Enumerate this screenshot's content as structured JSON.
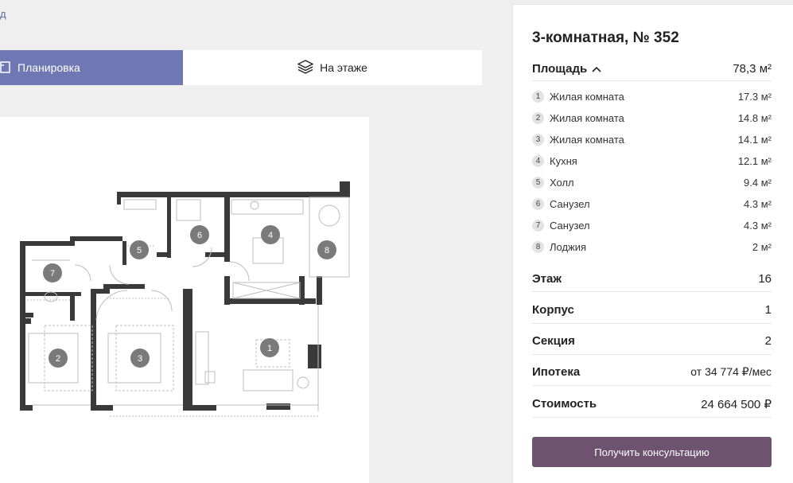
{
  "nav": {
    "back_label": "д"
  },
  "view_tabs": {
    "plan_label": "Планировка",
    "floor_label": "На этаже"
  },
  "apartment": {
    "title": "3-комнатная, № 352",
    "area_label": "Площадь",
    "area_value": "78,3 м²",
    "rooms": [
      {
        "num": "1",
        "name": "Жилая комната",
        "area": "17.3 м²"
      },
      {
        "num": "2",
        "name": "Жилая комната",
        "area": "14.8 м²"
      },
      {
        "num": "3",
        "name": "Жилая комната",
        "area": "14.1 м²"
      },
      {
        "num": "4",
        "name": "Кухня",
        "area": "12.1 м²"
      },
      {
        "num": "5",
        "name": "Холл",
        "area": "9.4 м²"
      },
      {
        "num": "6",
        "name": "Санузел",
        "area": "4.3 м²"
      },
      {
        "num": "7",
        "name": "Санузел",
        "area": "4.3 м²"
      },
      {
        "num": "8",
        "name": "Лоджия",
        "area": "2 м²"
      }
    ],
    "details": [
      {
        "label": "Этаж",
        "value": "16"
      },
      {
        "label": "Корпус",
        "value": "1"
      },
      {
        "label": "Секция",
        "value": "2"
      },
      {
        "label": "Ипотека",
        "value": "от 34 774 ₽/мес"
      },
      {
        "label": "Стоимость",
        "value": "24 664 500 ₽"
      }
    ],
    "cta_label": "Получить консультацию"
  },
  "plan_markers": [
    "1",
    "2",
    "3",
    "4",
    "5",
    "6",
    "7",
    "8"
  ],
  "colors": {
    "tab_active": "#6f78b3",
    "cta": "#6e5371",
    "marker": "#7a7a7a"
  }
}
